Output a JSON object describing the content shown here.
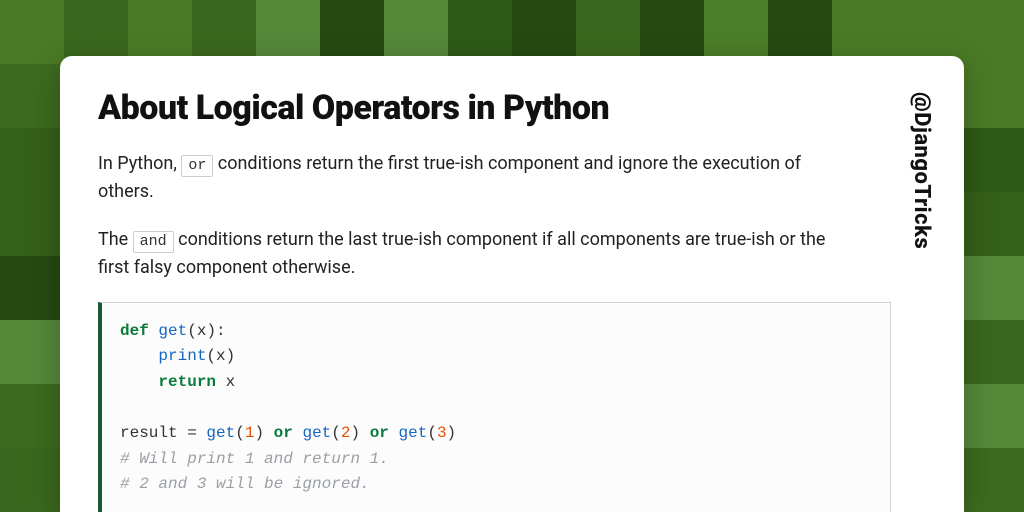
{
  "handle": "@DjangoTricks",
  "title": "About Logical Operators in Python",
  "para1_pre": "In Python, ",
  "para1_code": "or",
  "para1_post": " conditions return the first true-ish component and ignore the execution of others.",
  "para2_pre": "The ",
  "para2_code": "and",
  "para2_post": " conditions return the last true-ish component if all components are true-ish or the first falsy component otherwise.",
  "code": {
    "l1_def": "def",
    "l1_fn": "get",
    "l1_rest": "(x):",
    "l2_print": "print",
    "l2_rest": "(x)",
    "l3_return": "return",
    "l3_rest": " x",
    "l5_pre": "result = ",
    "l5_fn1": "get",
    "l5_p1a": "(",
    "l5_n1": "1",
    "l5_p1b": ") ",
    "l5_or1": "or",
    "l5_sp1": " ",
    "l5_fn2": "get",
    "l5_p2a": "(",
    "l5_n2": "2",
    "l5_p2b": ") ",
    "l5_or2": "or",
    "l5_sp2": " ",
    "l5_fn3": "get",
    "l5_p3a": "(",
    "l5_n3": "3",
    "l5_p3b": ")",
    "l6_comment": "# Will print 1 and return 1.",
    "l7_comment": "# 2 and 3 will be ignored."
  }
}
